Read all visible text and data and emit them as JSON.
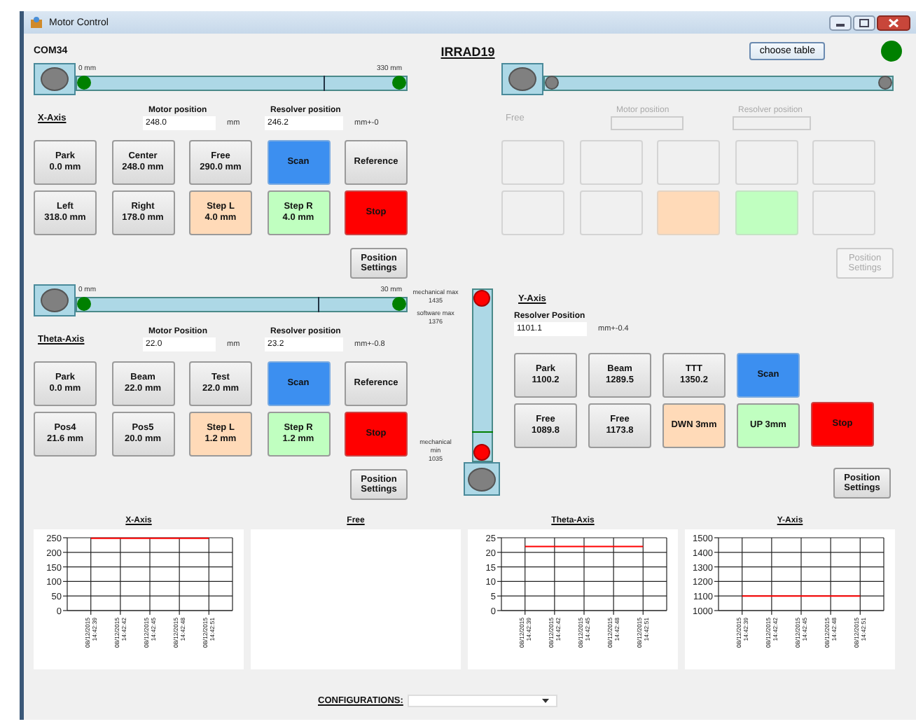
{
  "window": {
    "title": "Motor Control"
  },
  "header": {
    "port": "COM34",
    "title": "IRRAD19",
    "choose_button": "choose table",
    "connected": true
  },
  "top_panels": [
    {
      "title": "X-Axis",
      "disabled": false,
      "slider": {
        "min_label": "0 mm",
        "max_label": "330 mm",
        "level": 0.75
      },
      "motor": {
        "label": "Motor position",
        "value": "248.0",
        "unit": "mm"
      },
      "resolver": {
        "label": "Resolver position",
        "value": "246.2",
        "unit": "mm+-0"
      },
      "button_rows": [
        [
          {
            "kind": "preset",
            "label": "Park",
            "value": "0.0 mm"
          },
          {
            "kind": "preset",
            "label": "Center",
            "value": "248.0 mm"
          },
          {
            "kind": "preset",
            "label": "Free",
            "value": "290.0 mm"
          },
          {
            "kind": "scan",
            "label": "Scan"
          },
          {
            "kind": "preset",
            "label": "Reference"
          }
        ],
        [
          {
            "kind": "preset",
            "label": "Left",
            "value": "318.0 mm"
          },
          {
            "kind": "preset",
            "label": "Right",
            "value": "178.0 mm"
          },
          {
            "kind": "step_left",
            "label": "Step L",
            "value": "4.0 mm"
          },
          {
            "kind": "step_right",
            "label": "Step R",
            "value": "4.0 mm"
          },
          {
            "kind": "stop",
            "label": "Stop"
          }
        ]
      ],
      "settings_button": "Position Settings"
    },
    {
      "title": "Free",
      "disabled": true,
      "motor": {
        "label": "Motor position"
      },
      "resolver": {
        "label": "Resolver position"
      },
      "button_rows": [
        [
          {
            "kind": "blank"
          },
          {
            "kind": "blank"
          },
          {
            "kind": "blank"
          },
          {
            "kind": "blank"
          },
          {
            "kind": "blank"
          }
        ],
        [
          {
            "kind": "blank"
          },
          {
            "kind": "blank"
          },
          {
            "kind": "step_left"
          },
          {
            "kind": "step_right"
          },
          {
            "kind": "blank"
          }
        ]
      ],
      "settings_button": "Position Settings"
    }
  ],
  "theta_panel": {
    "title": "Theta-Axis",
    "disabled": false,
    "slider": {
      "min_label": "0 mm",
      "max_label": "30 mm",
      "level": 0.73
    },
    "motor": {
      "label": "Motor Position",
      "value": "22.0",
      "unit": "mm"
    },
    "resolver": {
      "label": "Resolver position",
      "value": "23.2",
      "unit": "mm+-0.8"
    },
    "button_rows": [
      [
        {
          "kind": "preset",
          "label": "Park",
          "value": "0.0 mm"
        },
        {
          "kind": "preset",
          "label": "Beam",
          "value": "22.0 mm"
        },
        {
          "kind": "preset",
          "label": "Test",
          "value": "22.0 mm"
        },
        {
          "kind": "scan",
          "label": "Scan"
        },
        {
          "kind": "preset",
          "label": "Reference"
        }
      ],
      [
        {
          "kind": "preset",
          "label": "Pos4",
          "value": "21.6 mm"
        },
        {
          "kind": "preset",
          "label": "Pos5",
          "value": "20.0 mm"
        },
        {
          "kind": "step_left",
          "label": "Step L",
          "value": "1.2 mm"
        },
        {
          "kind": "step_right",
          "label": "Step R",
          "value": "1.2 mm"
        },
        {
          "kind": "stop",
          "label": "Stop"
        }
      ]
    ],
    "settings_button": "Position Settings"
  },
  "vertical_slider": {
    "level": 0.165,
    "marks": [
      {
        "kind": "max",
        "lines": [
          "mechanical max",
          "1435"
        ]
      },
      {
        "kind": "max",
        "lines": [
          "software max",
          "1376"
        ]
      },
      {
        "kind": "min",
        "lines": [
          "mechanical",
          "min",
          "1035"
        ]
      }
    ]
  },
  "y_panel": {
    "title": "Y-Axis",
    "resolver": {
      "label": "Resolver Position",
      "value": "1101.1",
      "unit": "mm+-0.4"
    },
    "button_rows": [
      [
        {
          "kind": "preset",
          "label": "Park",
          "value": "1100.2"
        },
        {
          "kind": "preset",
          "label": "Beam",
          "value": "1289.5"
        },
        {
          "kind": "preset",
          "label": "TTT",
          "value": "1350.2"
        },
        {
          "kind": "scan",
          "label": "Scan"
        }
      ],
      [
        {
          "kind": "preset",
          "label": "Free",
          "value": "1089.8"
        },
        {
          "kind": "preset",
          "label": "Free",
          "value": "1173.8"
        },
        {
          "kind": "step_left",
          "label": "DWN 3mm"
        },
        {
          "kind": "step_right",
          "label": "UP 3mm"
        },
        {
          "kind": "stop",
          "label": "Stop"
        }
      ]
    ],
    "settings_button": "Position Settings"
  },
  "charts": [
    {
      "title": "X-Axis",
      "chart_data": {
        "type": "line",
        "x": [
          "08/12/2015 14:42:39",
          "08/12/2015 14:42:42",
          "08/12/2015 14:42:45",
          "08/12/2015 14:42:48",
          "08/12/2015 14:42:51"
        ],
        "ylim": [
          0,
          250
        ],
        "grid": true,
        "yticks": [
          0,
          50,
          100,
          150,
          200,
          250
        ],
        "series": [
          {
            "color": "#ff0000",
            "values": [
              248,
              248,
              248,
              248,
              248
            ]
          }
        ]
      }
    },
    {
      "title": "Free"
    },
    {
      "title": "Theta-Axis",
      "chart_data": {
        "type": "line",
        "x": [
          "08/12/2015 14:42:39",
          "08/12/2015 14:42:42",
          "08/12/2015 14:42:45",
          "08/12/2015 14:42:48",
          "08/12/2015 14:42:51"
        ],
        "ylim": [
          0,
          25
        ],
        "grid": true,
        "yticks": [
          0,
          5,
          10,
          15,
          20,
          25
        ],
        "series": [
          {
            "color": "#ff0000",
            "values": [
              22,
              22,
              22,
              22,
              22
            ]
          }
        ]
      }
    },
    {
      "title": "Y-Axis",
      "chart_data": {
        "type": "line",
        "x": [
          "08/12/2015 14:42:39",
          "08/12/2015 14:42:42",
          "08/12/2015 14:42:45",
          "08/12/2015 14:42:48",
          "08/12/2015 14:42:51"
        ],
        "ylim": [
          1000,
          1500
        ],
        "grid": true,
        "yticks": [
          1000,
          1100,
          1200,
          1300,
          1400,
          1500
        ],
        "series": [
          {
            "color": "#ff0000",
            "values": [
              1100,
              1100,
              1100,
              1100,
              1100
            ]
          }
        ]
      }
    }
  ],
  "configurations": {
    "label": "CONFIGURATIONS:"
  }
}
